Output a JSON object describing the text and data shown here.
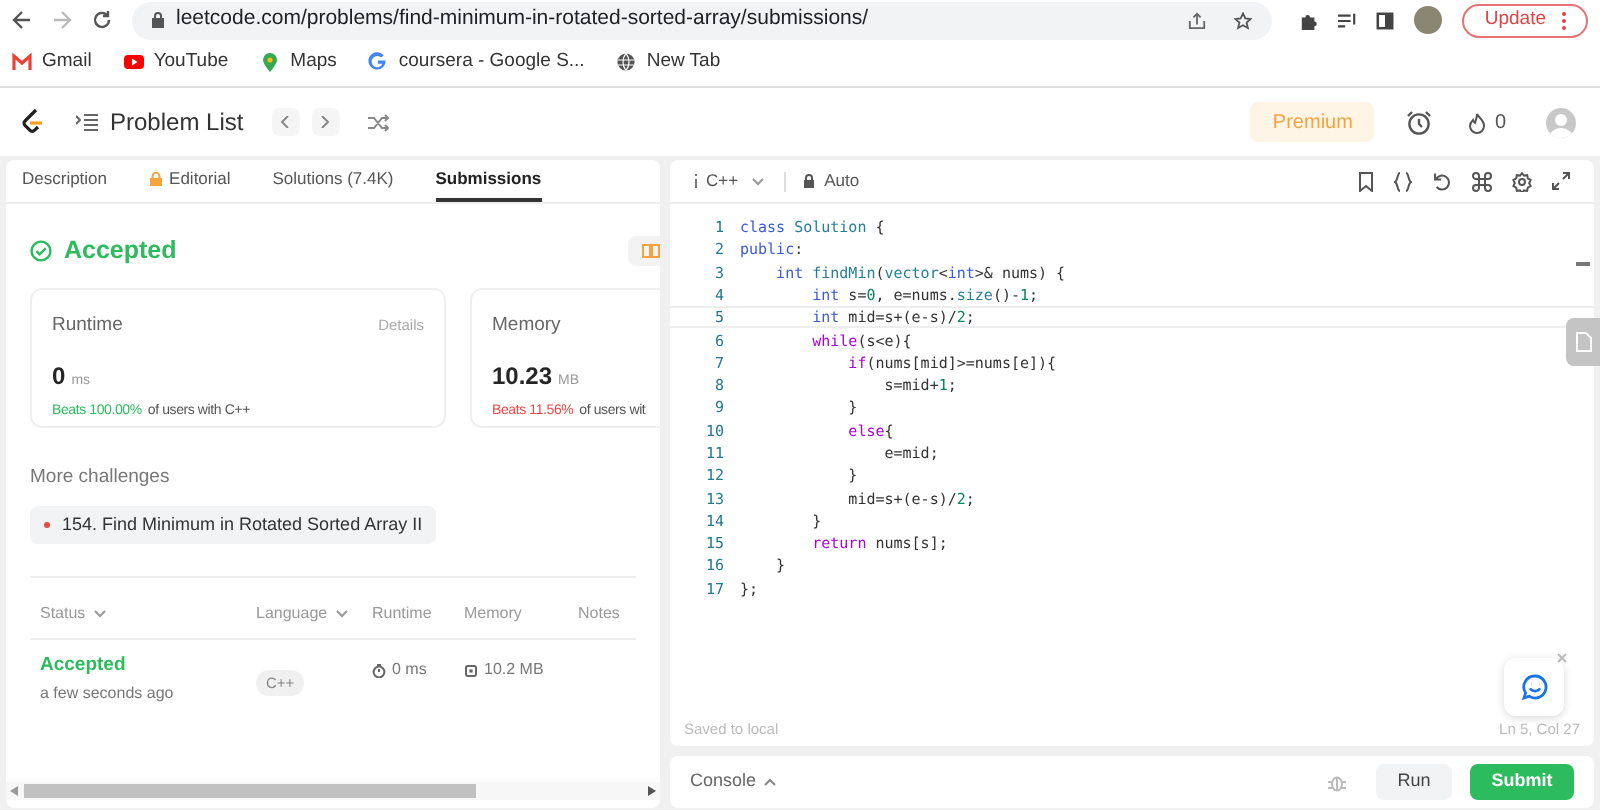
{
  "browser": {
    "url": "leetcode.com/problems/find-minimum-in-rotated-sorted-array/submissions/",
    "update_button": "Update"
  },
  "bookmarks": [
    {
      "label": "Gmail",
      "kind": "gmail"
    },
    {
      "label": "YouTube",
      "kind": "youtube"
    },
    {
      "label": "Maps",
      "kind": "maps"
    },
    {
      "label": "coursera - Google S...",
      "kind": "google"
    },
    {
      "label": "New Tab",
      "kind": "globe"
    }
  ],
  "nav": {
    "problem_list": "Problem List",
    "premium": "Premium",
    "streak_count": "0"
  },
  "tabs": [
    {
      "label": "Description",
      "selected": false,
      "locked": false
    },
    {
      "label": "Editorial",
      "selected": false,
      "locked": true
    },
    {
      "label": "Solutions (7.4K)",
      "selected": false,
      "locked": false
    },
    {
      "label": "Submissions",
      "selected": true,
      "locked": false
    }
  ],
  "result": {
    "status": "Accepted"
  },
  "stats": [
    {
      "title": "Runtime",
      "details": "Details",
      "value": "0",
      "unit": "ms",
      "beats": "Beats 100.00%",
      "beats_good": true,
      "suffix": "of users with C++"
    },
    {
      "title": "Memory",
      "value": "10.23",
      "unit": "MB",
      "beats": "Beats 11.56%",
      "beats_good": false,
      "suffix": "of users wit"
    }
  ],
  "more_challenges": {
    "title": "More challenges",
    "items": [
      {
        "label": "154. Find Minimum in Rotated Sorted Array II",
        "color": "#ef4743"
      }
    ]
  },
  "submissions": {
    "columns": [
      {
        "label": "Status",
        "dropdown": true
      },
      {
        "label": "Language",
        "dropdown": true
      },
      {
        "label": "Runtime",
        "dropdown": false
      },
      {
        "label": "Memory",
        "dropdown": false
      },
      {
        "label": "Notes",
        "dropdown": false
      }
    ],
    "rows": [
      {
        "status": "Accepted",
        "accepted": true,
        "time": "a few seconds ago",
        "language": "C++",
        "runtime": "0 ms",
        "memory": "10.2 MB"
      }
    ]
  },
  "editor": {
    "language": "C++",
    "mode": "Auto",
    "saved": "Saved to local",
    "cursor": "Ln 5, Col 27",
    "lines": [
      {
        "number": "1",
        "current": false,
        "tokens": [
          {
            "kind": "kw",
            "text": "class"
          },
          {
            "kind": "type",
            "text": " Solution"
          },
          {
            "kind": "p",
            "text": " {"
          }
        ]
      },
      {
        "number": "2",
        "current": false,
        "tokens": [
          {
            "kind": "kw",
            "text": "public"
          },
          {
            "kind": "p",
            "text": ":"
          }
        ]
      },
      {
        "number": "3",
        "current": false,
        "tokens": [
          {
            "kind": "kw",
            "text": "    int"
          },
          {
            "kind": "fn",
            "text": " findMin"
          },
          {
            "kind": "p",
            "text": "("
          },
          {
            "kind": "type",
            "text": "vector"
          },
          {
            "kind": "p",
            "text": "<"
          },
          {
            "kind": "kw",
            "text": "int"
          },
          {
            "kind": "p",
            "text": ">& nums) {"
          }
        ]
      },
      {
        "number": "4",
        "current": false,
        "tokens": [
          {
            "kind": "kw",
            "text": "        int"
          },
          {
            "kind": "p",
            "text": " s="
          },
          {
            "kind": "num",
            "text": "0"
          },
          {
            "kind": "p",
            "text": ", e=nums."
          },
          {
            "kind": "fn",
            "text": "size"
          },
          {
            "kind": "p",
            "text": "()-"
          },
          {
            "kind": "num",
            "text": "1"
          },
          {
            "kind": "p",
            "text": ";"
          }
        ]
      },
      {
        "number": "5",
        "current": true,
        "tokens": [
          {
            "kind": "kw",
            "text": "        int"
          },
          {
            "kind": "p",
            "text": " mid=s+(e-s)/"
          },
          {
            "kind": "num",
            "text": "2"
          },
          {
            "kind": "p",
            "text": ";"
          }
        ]
      },
      {
        "number": "6",
        "current": false,
        "tokens": [
          {
            "kind": "ctl",
            "text": "        while"
          },
          {
            "kind": "p",
            "text": "(s<e){"
          }
        ]
      },
      {
        "number": "7",
        "current": false,
        "tokens": [
          {
            "kind": "ctl",
            "text": "            if"
          },
          {
            "kind": "p",
            "text": "(nums[mid]>=nums[e]){"
          }
        ]
      },
      {
        "number": "8",
        "current": false,
        "tokens": [
          {
            "kind": "p",
            "text": "                s=mid+"
          },
          {
            "kind": "num",
            "text": "1"
          },
          {
            "kind": "p",
            "text": ";"
          }
        ]
      },
      {
        "number": "9",
        "current": false,
        "tokens": [
          {
            "kind": "p",
            "text": "            }"
          }
        ]
      },
      {
        "number": "10",
        "current": false,
        "tokens": [
          {
            "kind": "ctl",
            "text": "            else"
          },
          {
            "kind": "p",
            "text": "{"
          }
        ]
      },
      {
        "number": "11",
        "current": false,
        "tokens": [
          {
            "kind": "p",
            "text": "                e=mid;"
          }
        ]
      },
      {
        "number": "12",
        "current": false,
        "tokens": [
          {
            "kind": "p",
            "text": "            }"
          }
        ]
      },
      {
        "number": "13",
        "current": false,
        "tokens": [
          {
            "kind": "p",
            "text": "            mid=s+(e-s)/"
          },
          {
            "kind": "num",
            "text": "2"
          },
          {
            "kind": "p",
            "text": ";"
          }
        ]
      },
      {
        "number": "14",
        "current": false,
        "tokens": [
          {
            "kind": "p",
            "text": "        }"
          }
        ]
      },
      {
        "number": "15",
        "current": false,
        "tokens": [
          {
            "kind": "ctl",
            "text": "        return"
          },
          {
            "kind": "p",
            "text": " nums[s];"
          }
        ]
      },
      {
        "number": "16",
        "current": false,
        "tokens": [
          {
            "kind": "p",
            "text": "    }"
          }
        ]
      },
      {
        "number": "17",
        "current": false,
        "tokens": [
          {
            "kind": "p",
            "text": "};"
          }
        ]
      }
    ]
  },
  "console": {
    "label": "Console",
    "run": "Run",
    "submit": "Submit"
  }
}
